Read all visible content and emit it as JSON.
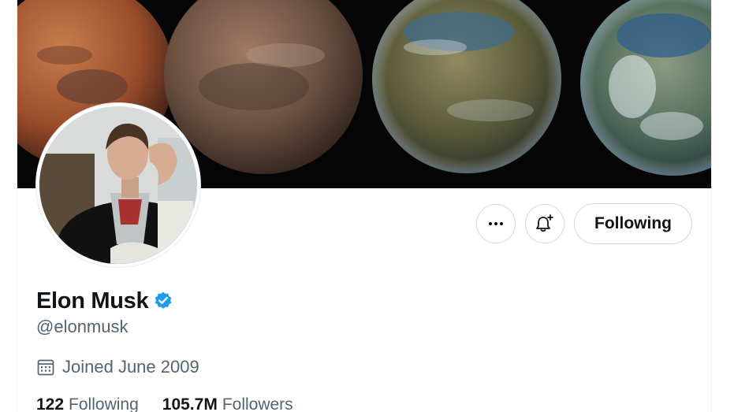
{
  "profile": {
    "display_name": "Elon Musk",
    "handle": "@elonmusk",
    "verified": true,
    "joined": "Joined June 2009",
    "following_count": "122",
    "following_label": "Following",
    "followers_count": "105.7M",
    "followers_label": "Followers"
  },
  "actions": {
    "more_icon": "more-icon",
    "notify_icon": "bell-plus-icon",
    "following_button": "Following"
  },
  "colors": {
    "accent": "#1d9bf0",
    "text": "#0f1419",
    "muted": "#536471",
    "border": "#cfd9de",
    "banner": "#050505"
  }
}
